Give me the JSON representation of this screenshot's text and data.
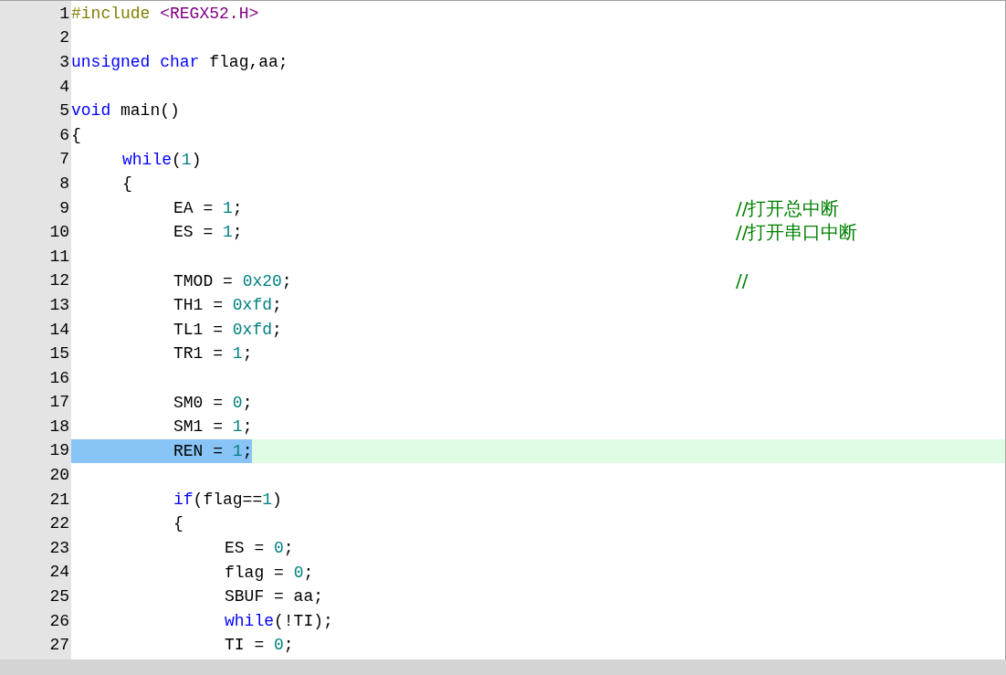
{
  "editor": {
    "lines": [
      {
        "number": "1",
        "current": false,
        "tokens": [
          {
            "kind": "pre",
            "text": "#include "
          },
          {
            "kind": "str",
            "text": "<REGX52.H>"
          }
        ]
      },
      {
        "number": "2",
        "current": false
      },
      {
        "number": "3",
        "current": false,
        "tokens": [
          {
            "kind": "kw",
            "text": "unsigned char"
          },
          {
            "kind": "plain",
            "text": " flag,aa;"
          }
        ]
      },
      {
        "number": "4",
        "current": false
      },
      {
        "number": "5",
        "current": false,
        "tokens": [
          {
            "kind": "kw",
            "text": "void"
          },
          {
            "kind": "plain",
            "text": " main()"
          }
        ]
      },
      {
        "number": "6",
        "current": false,
        "tokens": [
          {
            "kind": "plain",
            "text": "{"
          }
        ],
        "children": [
          {
            "number": "7",
            "current": false,
            "tokens": [
              {
                "kind": "kw",
                "text": "while"
              },
              {
                "kind": "plain",
                "text": "("
              },
              {
                "kind": "num",
                "text": "1"
              },
              {
                "kind": "plain",
                "text": ")"
              }
            ]
          },
          {
            "number": "8",
            "current": false,
            "tokens": [
              {
                "kind": "plain",
                "text": "{"
              }
            ],
            "children": [
              {
                "number": "9",
                "current": false,
                "tokens": [
                  {
                    "kind": "plain",
                    "text": "EA = "
                  },
                  {
                    "kind": "num",
                    "text": "1"
                  },
                  {
                    "kind": "plain",
                    "text": ";"
                  }
                ],
                "comment": "//打开总中断"
              },
              {
                "number": "10",
                "current": false,
                "tokens": [
                  {
                    "kind": "plain",
                    "text": "ES = "
                  },
                  {
                    "kind": "num",
                    "text": "1"
                  },
                  {
                    "kind": "plain",
                    "text": ";"
                  }
                ],
                "comment": "//打开串口中断"
              },
              {
                "number": "11",
                "current": false
              },
              {
                "number": "12",
                "current": false,
                "tokens": [
                  {
                    "kind": "plain",
                    "text": "TMOD = "
                  },
                  {
                    "kind": "num",
                    "text": "0x20"
                  },
                  {
                    "kind": "plain",
                    "text": ";"
                  }
                ],
                "comment": "//"
              },
              {
                "number": "13",
                "current": false,
                "tokens": [
                  {
                    "kind": "plain",
                    "text": "TH1 = "
                  },
                  {
                    "kind": "num",
                    "text": "0xfd"
                  },
                  {
                    "kind": "plain",
                    "text": ";"
                  }
                ]
              },
              {
                "number": "14",
                "current": false,
                "tokens": [
                  {
                    "kind": "plain",
                    "text": "TL1 = "
                  },
                  {
                    "kind": "num",
                    "text": "0xfd"
                  },
                  {
                    "kind": "plain",
                    "text": ";"
                  }
                ]
              },
              {
                "number": "15",
                "current": false,
                "tokens": [
                  {
                    "kind": "plain",
                    "text": "TR1 = "
                  },
                  {
                    "kind": "num",
                    "text": "1"
                  },
                  {
                    "kind": "plain",
                    "text": ";"
                  }
                ]
              },
              {
                "number": "16",
                "current": false
              },
              {
                "number": "17",
                "current": false,
                "tokens": [
                  {
                    "kind": "plain",
                    "text": "SM0 = "
                  },
                  {
                    "kind": "num",
                    "text": "0"
                  },
                  {
                    "kind": "plain",
                    "text": ";"
                  }
                ]
              },
              {
                "number": "18",
                "current": false,
                "tokens": [
                  {
                    "kind": "plain",
                    "text": "SM1 = "
                  },
                  {
                    "kind": "num",
                    "text": "1"
                  },
                  {
                    "kind": "plain",
                    "text": ";"
                  }
                ]
              },
              {
                "number": "19",
                "current": true,
                "selected": true,
                "tokens": [
                  {
                    "kind": "plain",
                    "text": "REN = "
                  },
                  {
                    "kind": "num",
                    "text": "1"
                  },
                  {
                    "kind": "plain",
                    "text": ";"
                  }
                ]
              },
              {
                "number": "20",
                "current": false
              },
              {
                "number": "21",
                "current": false,
                "tokens": [
                  {
                    "kind": "kw",
                    "text": "if"
                  },
                  {
                    "kind": "plain",
                    "text": "(flag=="
                  },
                  {
                    "kind": "num",
                    "text": "1"
                  },
                  {
                    "kind": "plain",
                    "text": ")"
                  }
                ]
              },
              {
                "number": "22",
                "current": false,
                "tokens": [
                  {
                    "kind": "plain",
                    "text": "{"
                  }
                ],
                "children": [
                  {
                    "number": "23",
                    "current": false,
                    "tokens": [
                      {
                        "kind": "plain",
                        "text": "ES = "
                      },
                      {
                        "kind": "num",
                        "text": "0"
                      },
                      {
                        "kind": "plain",
                        "text": ";"
                      }
                    ]
                  },
                  {
                    "number": "24",
                    "current": false,
                    "tokens": [
                      {
                        "kind": "plain",
                        "text": "flag = "
                      },
                      {
                        "kind": "num",
                        "text": "0"
                      },
                      {
                        "kind": "plain",
                        "text": ";"
                      }
                    ]
                  },
                  {
                    "number": "25",
                    "current": false,
                    "tokens": [
                      {
                        "kind": "plain",
                        "text": "SBUF = aa;"
                      }
                    ]
                  },
                  {
                    "number": "26",
                    "current": false,
                    "tokens": [
                      {
                        "kind": "kw",
                        "text": "while"
                      },
                      {
                        "kind": "plain",
                        "text": "(!TI);"
                      }
                    ]
                  },
                  {
                    "number": "27",
                    "current": false,
                    "tokens": [
                      {
                        "kind": "plain",
                        "text": "TI = "
                      },
                      {
                        "kind": "num",
                        "text": "0"
                      },
                      {
                        "kind": "plain",
                        "text": ";"
                      }
                    ]
                  }
                ]
              }
            ]
          }
        ]
      }
    ]
  }
}
